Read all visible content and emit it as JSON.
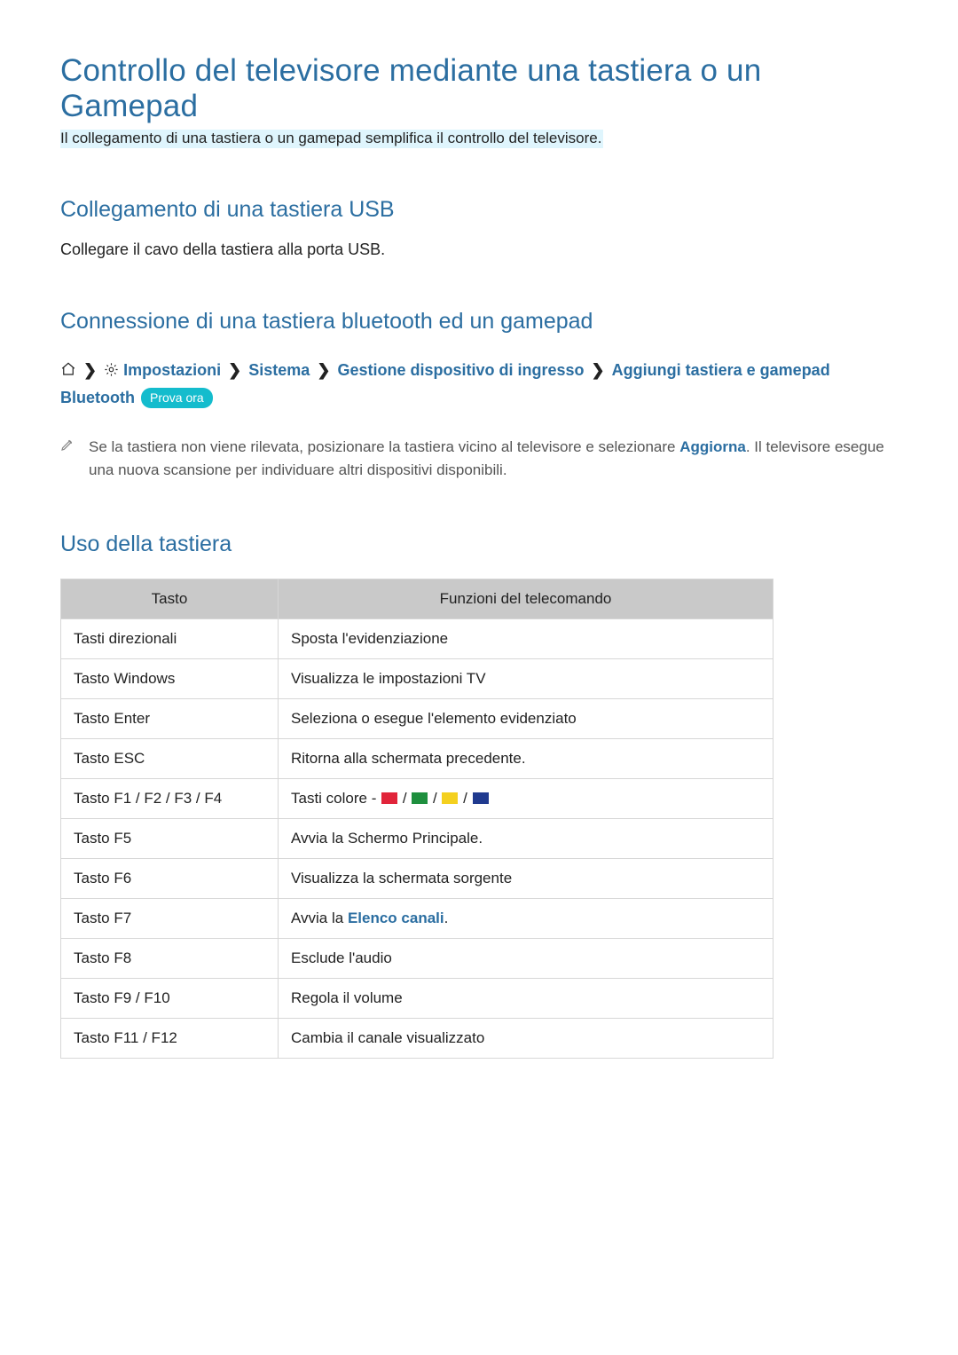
{
  "title": "Controllo del televisore mediante una tastiera o un Gamepad",
  "subtitle": "Il collegamento di una tastiera o un gamepad semplifica il controllo del televisore.",
  "section_usb": {
    "heading": "Collegamento di una tastiera USB",
    "body": "Collegare il cavo della tastiera alla porta USB."
  },
  "section_bt": {
    "heading": "Connessione di una tastiera bluetooth ed un gamepad",
    "breadcrumb": {
      "items": [
        "Impostazioni",
        "Sistema",
        "Gestione dispositivo di ingresso",
        "Aggiungi tastiera e gamepad Bluetooth"
      ],
      "badge": "Prova ora"
    },
    "note": {
      "pre": "Se la tastiera non viene rilevata, posizionare la tastiera vicino al televisore e selezionare ",
      "highlight": "Aggiorna",
      "post": ". Il televisore esegue una nuova scansione per individuare altri dispositivi disponibili."
    }
  },
  "section_kb": {
    "heading": "Uso della tastiera",
    "table": {
      "headers": [
        "Tasto",
        "Funzioni del telecomando"
      ],
      "rows": [
        {
          "key": "Tasti direzionali",
          "func_type": "text",
          "func": "Sposta l'evidenziazione"
        },
        {
          "key": "Tasto Windows",
          "func_type": "text",
          "func": "Visualizza le impostazioni TV"
        },
        {
          "key": "Tasto Enter",
          "func_type": "text",
          "func": "Seleziona o esegue l'elemento evidenziato"
        },
        {
          "key": "Tasto ESC",
          "func_type": "text",
          "func": "Ritorna alla schermata precedente."
        },
        {
          "key": "Tasto F1 / F2 / F3 / F4",
          "func_type": "colors",
          "func_prefix": "Tasti colore - "
        },
        {
          "key": "Tasto F5",
          "func_type": "text",
          "func": "Avvia la Schermo Principale."
        },
        {
          "key": "Tasto F6",
          "func_type": "text",
          "func": "Visualizza la schermata sorgente"
        },
        {
          "key": "Tasto F7",
          "func_type": "link",
          "func_pre": "Avvia la ",
          "func_link": "Elenco canali",
          "func_post": "."
        },
        {
          "key": "Tasto F8",
          "func_type": "text",
          "func": "Esclude l'audio"
        },
        {
          "key": "Tasto F9 / F10",
          "func_type": "text",
          "func": "Regola il volume"
        },
        {
          "key": "Tasto F11 / F12",
          "func_type": "text",
          "func": "Cambia il canale visualizzato"
        }
      ]
    }
  }
}
